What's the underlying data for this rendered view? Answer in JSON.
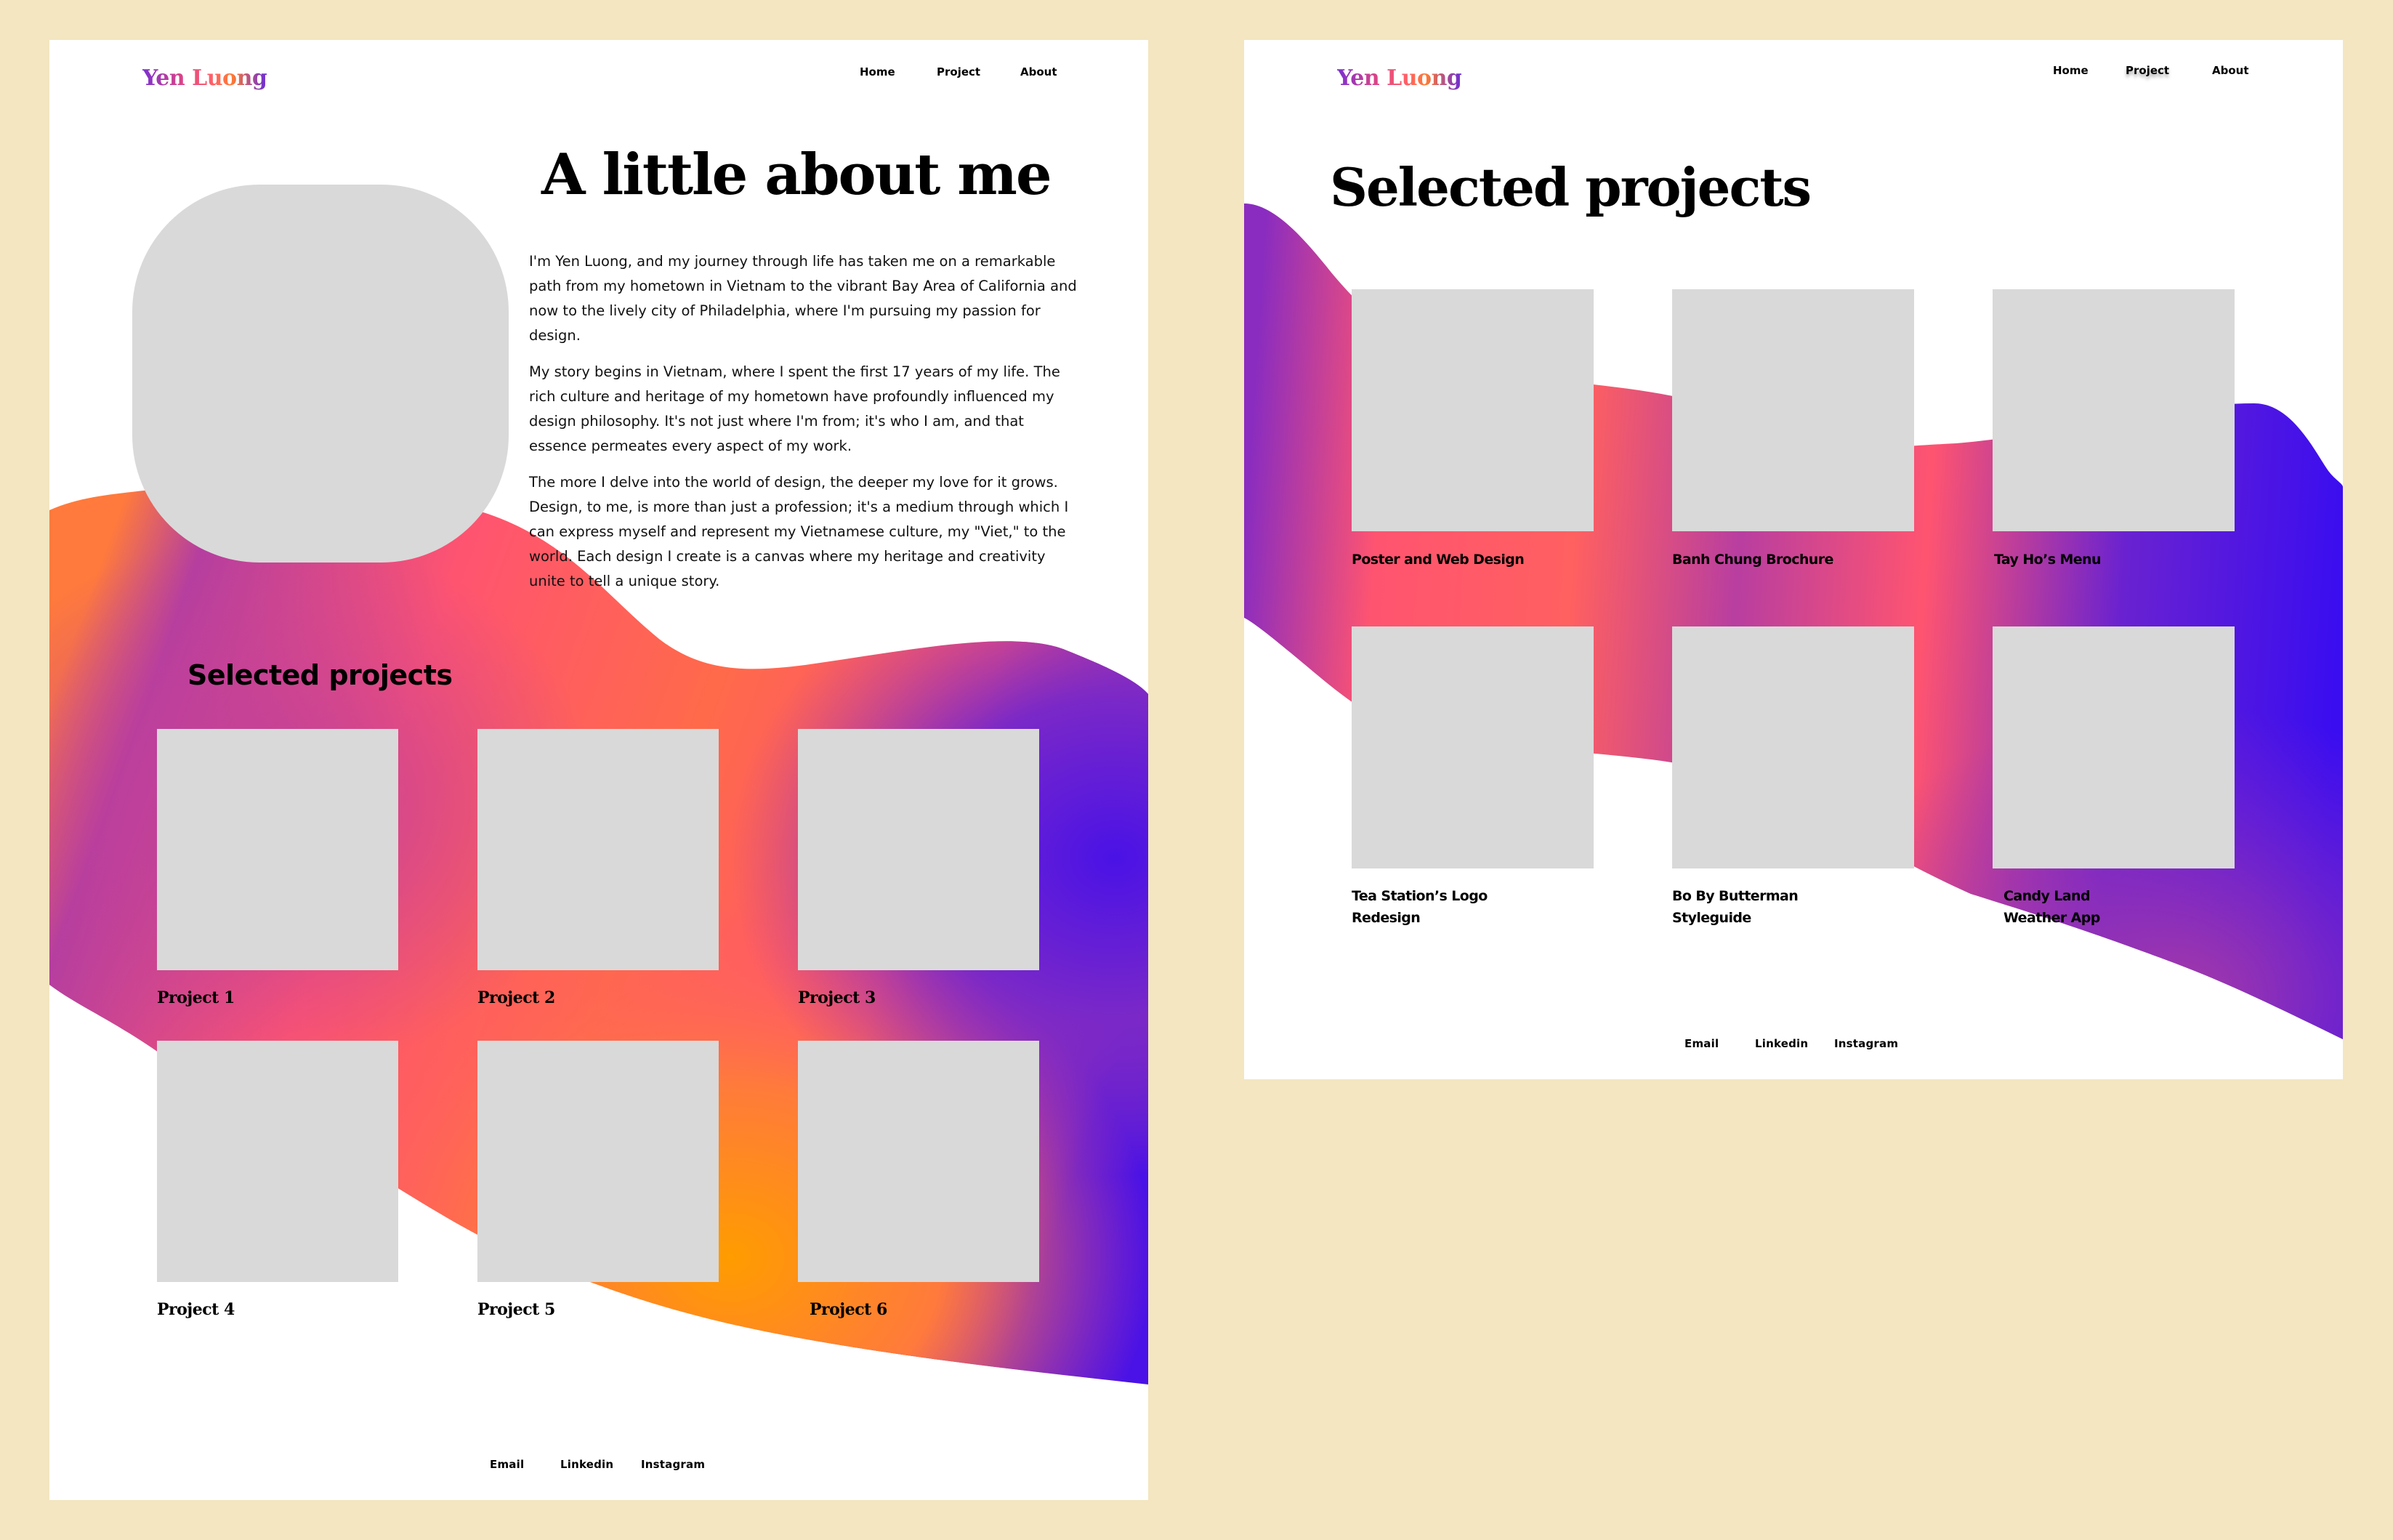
{
  "colors": {
    "background": "#f3e6c0",
    "page": "#ffffff",
    "placeholder": "#d9d9d9",
    "gradient_purple": "#8e2fc0",
    "gradient_pink": "#ff5470",
    "gradient_orange": "#ff9a00",
    "gradient_indigo": "#3a0df0"
  },
  "about_page": {
    "logo": "Yen Luong",
    "nav": [
      {
        "label": "Home"
      },
      {
        "label": "Project"
      },
      {
        "label": "About"
      }
    ],
    "title": "A little about me",
    "bio": [
      "I'm Yen Luong, and my journey through life has taken me on a remarkable path from my hometown in Vietnam to the vibrant Bay Area of California and now to the lively city of Philadelphia, where I'm pursuing my passion for design.",
      "My story begins in Vietnam, where I spent the first 17 years of my life. The rich culture and heritage of my hometown have profoundly influenced my design philosophy. It's not just where I'm from; it's who I am, and that essence permeates every aspect of my work.",
      "The more I delve into the world of design, the deeper my love for it grows. Design, to me, is more than just a profession; it's a medium through which I can express myself and represent my Vietnamese culture, my \"Viet,\" to the world. Each design I create is a canvas where my heritage and creativity unite to tell a unique story."
    ],
    "section_title": "Selected projects",
    "projects": [
      {
        "label": "Project 1"
      },
      {
        "label": "Project 2"
      },
      {
        "label": "Project 3"
      },
      {
        "label": "Project 4"
      },
      {
        "label": "Project 5"
      },
      {
        "label": "Project 6"
      }
    ],
    "footer": [
      {
        "label": "Email"
      },
      {
        "label": "Linkedin"
      },
      {
        "label": "Instagram"
      }
    ]
  },
  "projects_page": {
    "logo": "Yen Luong",
    "nav": [
      {
        "label": "Home"
      },
      {
        "label": "Project",
        "active": true
      },
      {
        "label": "About"
      }
    ],
    "title": "Selected projects",
    "projects": [
      {
        "label": "Poster and Web Design"
      },
      {
        "label": "Banh Chung Brochure"
      },
      {
        "label": "Tay Ho’s Menu"
      },
      {
        "label": "Tea Station’s Logo Redesign"
      },
      {
        "label": "Bo By Butterman Styleguide"
      },
      {
        "label": "Candy Land Weather App"
      }
    ],
    "footer": [
      {
        "label": "Email"
      },
      {
        "label": "Linkedin"
      },
      {
        "label": "Instagram"
      }
    ]
  }
}
